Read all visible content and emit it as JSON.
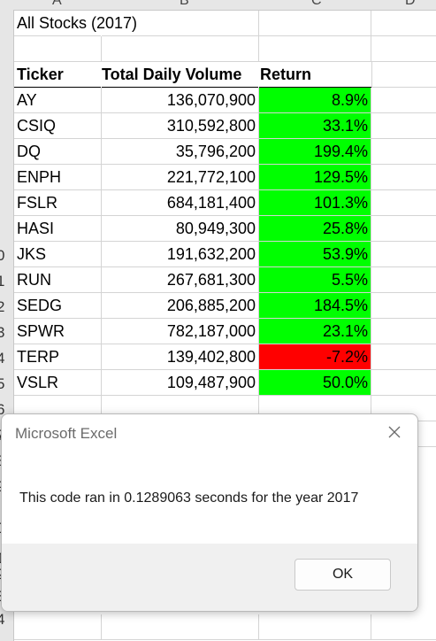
{
  "column_headers": [
    "A",
    "B",
    "C",
    "D"
  ],
  "row_numbers": [
    "0",
    "1",
    "2",
    "3",
    "4",
    "5",
    "6",
    "7",
    "8",
    "9",
    "0",
    "1",
    "2",
    "3",
    "4"
  ],
  "sheet": {
    "title": "All Stocks (2017)",
    "headers": [
      "Ticker",
      "Total Daily Volume",
      "Return"
    ],
    "rows": [
      {
        "ticker": "AY",
        "volume": "136,070,900",
        "return": "8.9%",
        "status": "positive"
      },
      {
        "ticker": "CSIQ",
        "volume": "310,592,800",
        "return": "33.1%",
        "status": "positive"
      },
      {
        "ticker": "DQ",
        "volume": "35,796,200",
        "return": "199.4%",
        "status": "positive"
      },
      {
        "ticker": "ENPH",
        "volume": "221,772,100",
        "return": "129.5%",
        "status": "positive"
      },
      {
        "ticker": "FSLR",
        "volume": "684,181,400",
        "return": "101.3%",
        "status": "positive"
      },
      {
        "ticker": "HASI",
        "volume": "80,949,300",
        "return": "25.8%",
        "status": "positive"
      },
      {
        "ticker": "JKS",
        "volume": "191,632,200",
        "return": "53.9%",
        "status": "positive"
      },
      {
        "ticker": "RUN",
        "volume": "267,681,300",
        "return": "5.5%",
        "status": "positive"
      },
      {
        "ticker": "SEDG",
        "volume": "206,885,200",
        "return": "184.5%",
        "status": "positive"
      },
      {
        "ticker": "SPWR",
        "volume": "782,187,000",
        "return": "23.1%",
        "status": "positive"
      },
      {
        "ticker": "TERP",
        "volume": "139,402,800",
        "return": "-7.2%",
        "status": "negative"
      },
      {
        "ticker": "VSLR",
        "volume": "109,487,900",
        "return": "50.0%",
        "status": "positive"
      }
    ]
  },
  "colors": {
    "positive": "#00ff00",
    "negative": "#ff0000"
  },
  "dialog": {
    "title": "Microsoft Excel",
    "message": "This code ran in 0.1289063 seconds for the year 2017",
    "ok_label": "OK",
    "close_icon": "close-icon"
  }
}
